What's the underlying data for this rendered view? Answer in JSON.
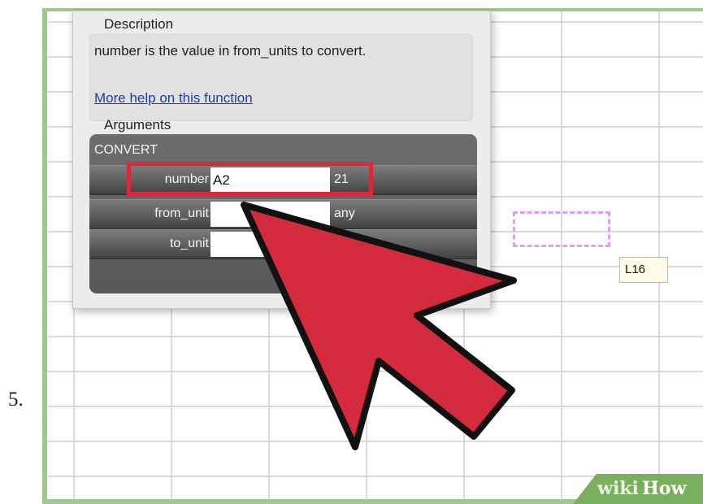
{
  "step_label": "5.",
  "dialog": {
    "description_heading": "Description",
    "description_text": "number is the value in from_units to convert.",
    "help_link": "More help on this function",
    "arguments_heading": "Arguments",
    "function_name": "CONVERT",
    "args": [
      {
        "label": "number",
        "value": "A2",
        "result": "21"
      },
      {
        "label": "from_unit",
        "value": "",
        "result": "any"
      },
      {
        "label": "to_unit",
        "value": "",
        "result": ""
      }
    ]
  },
  "cell_tooltip": "L16",
  "watermark": {
    "part1": "wiki",
    "part2": "How"
  },
  "colors": {
    "frame_green": "#9fc88c",
    "highlight_red": "#d8283b",
    "arrow_red": "#d42a3e",
    "selection_purple": "#d9a2f0",
    "link_blue": "#1a3db5"
  },
  "icons": {
    "pointer": "red-arrow-icon"
  }
}
